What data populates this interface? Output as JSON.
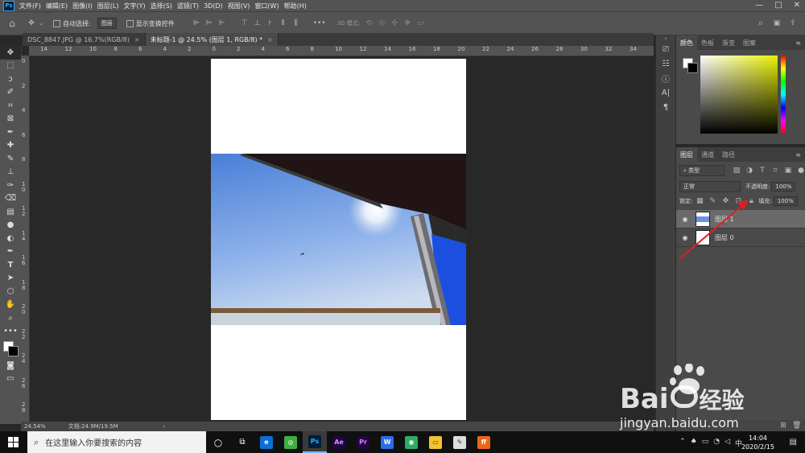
{
  "menubar": {
    "logo": "Ps",
    "items": [
      "文件(F)",
      "编辑(E)",
      "图像(I)",
      "图层(L)",
      "文字(Y)",
      "选择(S)",
      "滤镜(T)",
      "3D(D)",
      "视图(V)",
      "窗口(W)",
      "帮助(H)"
    ],
    "min": "—",
    "max": "□",
    "close": "✕"
  },
  "options": {
    "auto_select_label": "自动选择:",
    "auto_select_value": "图层",
    "show_transform_label": "显示变换控件",
    "mode_3d_label": "3D 模式:"
  },
  "tabs": [
    {
      "label": "DSC_8847.JPG @ 16.7%(RGB/8)",
      "close": "×"
    },
    {
      "label": "未标题-1 @ 24.5% (图层 1, RGB/8) *",
      "close": "×"
    }
  ],
  "ruler": {
    "h_ticks": [
      "14",
      "12",
      "10",
      "8",
      "6",
      "4",
      "2",
      "0",
      "2",
      "4",
      "6",
      "8",
      "10",
      "12",
      "14",
      "16",
      "18",
      "20",
      "22",
      "24",
      "26",
      "28",
      "30",
      "32",
      "34"
    ],
    "v_ticks": [
      "0",
      "2",
      "4",
      "6",
      "8",
      "1 0",
      "1 2",
      "1 4",
      "1 6",
      "1 8",
      "2 0",
      "2 2",
      "2 4",
      "2 6",
      "2 8"
    ]
  },
  "status": {
    "zoom": "24.54%",
    "doc": "文档:24.9M/19.5M"
  },
  "color_panel": {
    "tabs": [
      "颜色",
      "色板",
      "渐变",
      "图案"
    ],
    "hue_color": "#e8f000"
  },
  "layers_panel": {
    "tabs": [
      "图层",
      "通道",
      "路径"
    ],
    "filter_label": "类型",
    "blend_mode": "正常",
    "opacity_label": "不透明度:",
    "opacity_value": "100%",
    "lock_label": "锁定:",
    "fill_label": "填充:",
    "fill_value": "100%",
    "layers": [
      {
        "name": "图层 1",
        "selected": true
      },
      {
        "name": "图层 0",
        "selected": false
      }
    ]
  },
  "taskbar": {
    "search_placeholder": "在这里输入你要搜索的内容",
    "apps": [
      {
        "name": "edge",
        "label": "e",
        "bg": "#0a6fd6",
        "fg": "#ffffff"
      },
      {
        "name": "chrome-like",
        "label": "◎",
        "bg": "#3cb043",
        "fg": "#ffffff"
      },
      {
        "name": "photoshop",
        "label": "Ps",
        "bg": "#001e36",
        "fg": "#31a8ff"
      },
      {
        "name": "after-effects",
        "label": "Ae",
        "bg": "#1f0740",
        "fg": "#d291ff"
      },
      {
        "name": "premiere",
        "label": "Pr",
        "bg": "#1f0740",
        "fg": "#ea77ff"
      },
      {
        "name": "wps",
        "label": "W",
        "bg": "#2b6de8",
        "fg": "#ffffff"
      },
      {
        "name": "wechat",
        "label": "◉",
        "bg": "#2aae67",
        "fg": "#ffffff"
      },
      {
        "name": "explorer",
        "label": "▭",
        "bg": "#f1c232",
        "fg": "#5a4000"
      },
      {
        "name": "app-grey",
        "label": "✎",
        "bg": "#dddddd",
        "fg": "#333333"
      },
      {
        "name": "firefox",
        "label": "ff",
        "bg": "#e8661a",
        "fg": "#ffffff"
      }
    ],
    "ime": "中",
    "time": "14:04",
    "date": "2020/2/15"
  },
  "watermark": {
    "brand": "Bai",
    "brand_suffix": "经验",
    "url": "jingyan.baidu.com"
  }
}
